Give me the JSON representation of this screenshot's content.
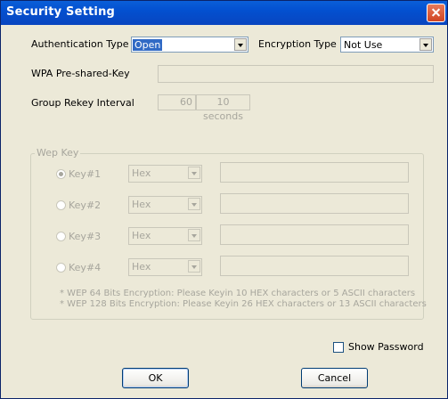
{
  "window": {
    "title": "Security Setting"
  },
  "auth": {
    "label": "Authentication Type",
    "value": "Open"
  },
  "encryption": {
    "label": "Encryption Type",
    "value": "Not Use"
  },
  "wpa": {
    "label": "WPA Pre-shared-Key",
    "value": ""
  },
  "rekey": {
    "label": "Group Rekey Interval",
    "value": "60",
    "unit_button": "10 seconds"
  },
  "wep": {
    "legend": "Wep Key",
    "keys": [
      {
        "label": "Key#1",
        "format": "Hex",
        "selected": true,
        "value": ""
      },
      {
        "label": "Key#2",
        "format": "Hex",
        "selected": false,
        "value": ""
      },
      {
        "label": "Key#3",
        "format": "Hex",
        "selected": false,
        "value": ""
      },
      {
        "label": "Key#4",
        "format": "Hex",
        "selected": false,
        "value": ""
      }
    ],
    "notes": [
      "* WEP 64 Bits Encryption:  Please Keyin 10 HEX characters or 5 ASCII characters",
      "* WEP 128 Bits Encryption:  Please Keyin 26 HEX characters or 13 ASCII characters"
    ]
  },
  "show_password": {
    "label": "Show Password",
    "checked": false
  },
  "buttons": {
    "ok": "OK",
    "cancel": "Cancel"
  },
  "colors": {
    "titlebar": "#0350d0",
    "dialog_bg": "#ece9d8",
    "disabled_text": "#a7a69d",
    "selection": "#316ac5"
  }
}
